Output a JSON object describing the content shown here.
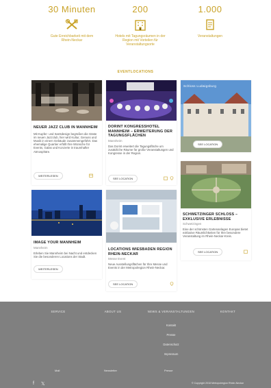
{
  "stats": [
    {
      "number": "30 Minuten",
      "icon": "tools-icon",
      "desc": [
        "Gute Erreichbarkeit mit dem",
        "Rhein-Neckar"
      ]
    },
    {
      "number": "200",
      "icon": "building-icon",
      "desc": [
        "Hotels mit Tagungsräumen in der",
        "Region mit Vorteilen für",
        "Veranstaltungsorte"
      ]
    },
    {
      "number": "1.000",
      "icon": "document-icon",
      "desc": [
        "Veranstaltungen"
      ]
    }
  ],
  "section_title": "EVENTLOCATIONS",
  "cards": [
    {
      "id": "jazz",
      "title": "NEUER JAZZ CLUB IN MANNHEIM",
      "subtitle": "",
      "text": "Mit Kupfer- und Samtdesign begrüßen die Gäste im neuen Jazzclub, hier wird Kultur, Genuss und Musik in einem Gebäude zusammengeführt. Das ehemalige Quartier erfüllt Ihre Wünsche für Events, Galas und Konzerte in traumhafter Atmosphäre.",
      "button": "WEITERLESEN"
    },
    {
      "id": "dorint",
      "title": "DORINT KONGRESSHOTEL MANNHEIM – ERWEITERUNG DER TAGUNGSFLÄCHEN",
      "subtitle": "Mannheim",
      "text": "Das Dorint erweitert die Tagungsfläche um zusätzliche Räume für große Veranstaltungen und Kongresse in der Region.",
      "button": "SEE LOCATION"
    },
    {
      "id": "ludwigsburg",
      "title": "",
      "subtitle": "",
      "text": "",
      "image_caption": "Schloss Ludwigsburg",
      "button": "SEE LOCATION"
    },
    {
      "id": "mannheim-night",
      "title": "IMAGE YOUR MANNHEIM",
      "subtitle": "Mannheim",
      "text": "Erleben Sie Mannheim bei Nacht und entdecken Sie die besonderen Locations der Stadt.",
      "button": "WEITERLESEN"
    },
    {
      "id": "messe",
      "title": "LOCATIONS WIESBADEN REGION RHEIN-NECKAR",
      "subtitle": "Messe Event",
      "text": "Neue Ausstellungsflächen für Ihre Messe und Events in der Metropolregion Rhein-Neckar.",
      "button": "SEE LOCATION"
    },
    {
      "id": "schwetzingen",
      "title": "SCHWETZINGER SCHLOSS – EXKLUSIVE ERLEBNISSE",
      "subtitle": "Schwetzingen",
      "text": "Eine der schönsten Gartenanlagen Europas bietet exklusive Räumlichkeiten für Ihre besondere Veranstaltung im Rhein-Neckar-Kreis.",
      "button": "SEE LOCATION"
    }
  ],
  "footer": {
    "columns": [
      "SERVICE",
      "ABOUT US",
      "NEWS & VERANSTALTUNGEN",
      "KONTAKT"
    ],
    "links": [
      "Kontakt",
      "Presse",
      "Datenschutz",
      "Impressum"
    ],
    "bottom_left": "Mail",
    "bottom_middle": "Newsletter",
    "bottom_right": "Presse",
    "copyright": "© Copyright 2018 Metropolregion Rhein-Neckar"
  }
}
